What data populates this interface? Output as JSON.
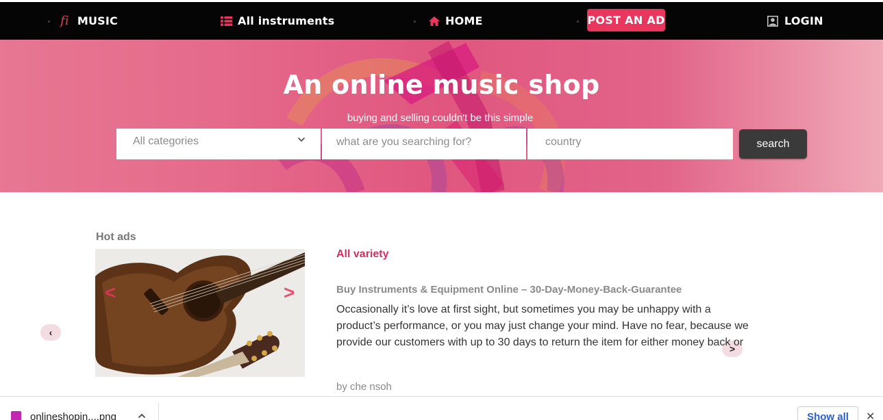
{
  "navbar": {
    "brand_icon": "fi",
    "brand_label": "MUSIC",
    "instruments_label": "All instruments",
    "home_label": "HOME",
    "post_ad_label": "POST AN AD",
    "login_label": "LOGIN"
  },
  "hero": {
    "title": "An online music shop",
    "subtitle": "buying and selling couldn't be this simple",
    "category_select": "All categories",
    "search_placeholder": "what are you searching for?",
    "country_placeholder": "country",
    "search_button": "search"
  },
  "hot_ads": {
    "label": "Hot ads",
    "prev_arrow": "<",
    "next_arrow": ">"
  },
  "carousel": {
    "prev": "‹",
    "next": ">"
  },
  "ad": {
    "title": "All variety",
    "headline": "Buy Instruments & Equipment Online – 30-Day-Money-Back-Guarantee",
    "body": "Occasionally it’s love at first sight, but sometimes you may be unhappy with a product’s performance, or you may just change your mind. Have no fear, because we provide our customers with up to 30 days to return the item for either money back or store credit.",
    "author": "by che nsoh"
  },
  "download_bar": {
    "file_name": "onlineshopin....png",
    "show_all": "Show all",
    "close": "✕"
  },
  "colors": {
    "accent": "#e8365d",
    "navbar_bg": "#050505",
    "hero_bg": "#e0567f",
    "search_button_bg": "#3a3a3a"
  },
  "icons": [
    "list-icon",
    "home-icon",
    "user-icon",
    "chevron-down-icon",
    "file-icon",
    "close-icon"
  ]
}
